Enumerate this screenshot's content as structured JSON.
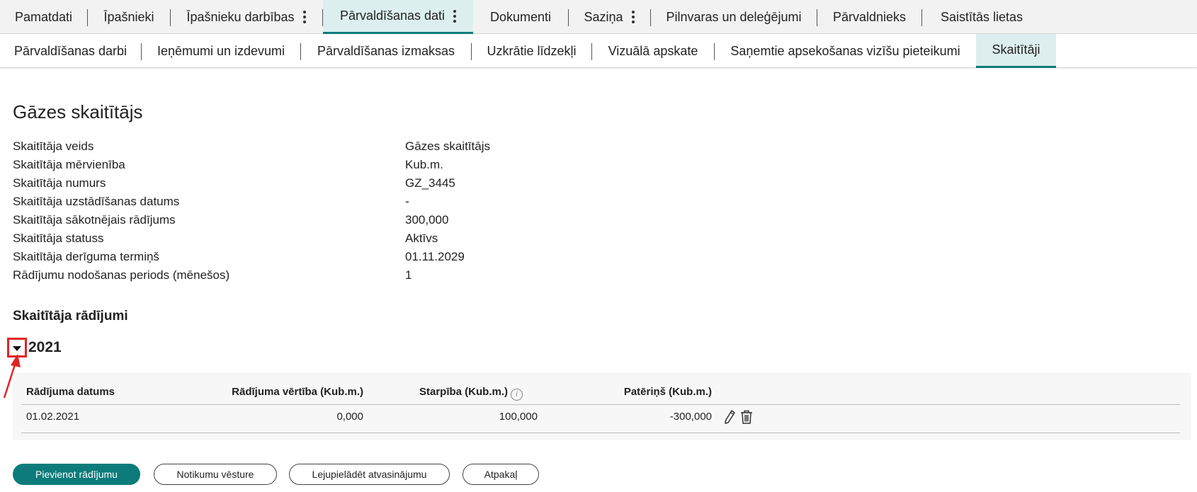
{
  "tabs_primary": [
    {
      "label": "Pamatdati",
      "active": false,
      "menu": false
    },
    {
      "label": "Īpašnieki",
      "active": false,
      "menu": false
    },
    {
      "label": "Īpašnieku darbības",
      "active": false,
      "menu": true
    },
    {
      "label": "Pārvaldīšanas dati",
      "active": true,
      "menu": true
    },
    {
      "label": "Dokumenti",
      "active": false,
      "menu": false
    },
    {
      "label": "Saziņa",
      "active": false,
      "menu": true
    },
    {
      "label": "Pilnvaras un deleģējumi",
      "active": false,
      "menu": false
    },
    {
      "label": "Pārvaldnieks",
      "active": false,
      "menu": false
    },
    {
      "label": "Saistītās lietas",
      "active": false,
      "menu": false
    }
  ],
  "tabs_secondary": [
    {
      "label": "Pārvaldīšanas darbi",
      "active": false
    },
    {
      "label": "Ieņēmumi un izdevumi",
      "active": false
    },
    {
      "label": "Pārvaldīšanas izmaksas",
      "active": false
    },
    {
      "label": "Uzkrātie līdzekļi",
      "active": false
    },
    {
      "label": "Vizuālā apskate",
      "active": false
    },
    {
      "label": "Saņemtie apsekošanas vizīšu pieteikumi",
      "active": false
    },
    {
      "label": "Skaitītāji",
      "active": true
    }
  ],
  "page_title": "Gāzes skaitītājs",
  "fields": [
    {
      "label": "Skaitītāja veids",
      "value": "Gāzes skaitītājs"
    },
    {
      "label": "Skaitītāja mērvienība",
      "value": "Kub.m."
    },
    {
      "label": "Skaitītāja numurs",
      "value": "GZ_3445"
    },
    {
      "label": "Skaitītāja uzstādīšanas datums",
      "value": "-"
    },
    {
      "label": "Skaitītāja sākotnējais rādījums",
      "value": "300,000"
    },
    {
      "label": "Skaitītāja statuss",
      "value": "Aktīvs"
    },
    {
      "label": "Skaitītāja derīguma termiņš",
      "value": "01.11.2029"
    },
    {
      "label": "Rādījumu nodošanas periods (mēnešos)",
      "value": "1"
    }
  ],
  "readings": {
    "section_title": "Skaitītāja rādījumi",
    "year": "2021",
    "columns": {
      "date": "Rādījuma datums",
      "value": "Rādījuma vērtība (Kub.m.)",
      "difference": "Starpība (Kub.m.)",
      "consumption": "Patēriņš (Kub.m.)"
    },
    "rows": [
      {
        "date": "01.02.2021",
        "value": "0,000",
        "difference": "100,000",
        "consumption": "-300,000"
      }
    ]
  },
  "buttons": {
    "add": "Pievienot rādījumu",
    "history": "Notikumu vēsture",
    "download": "Lejupielādēt atvasinājumu",
    "back": "Atpakaļ"
  },
  "colors": {
    "accent": "#0d7b7b",
    "active_tab_bg": "#dcefee",
    "highlight": "#e02424"
  }
}
